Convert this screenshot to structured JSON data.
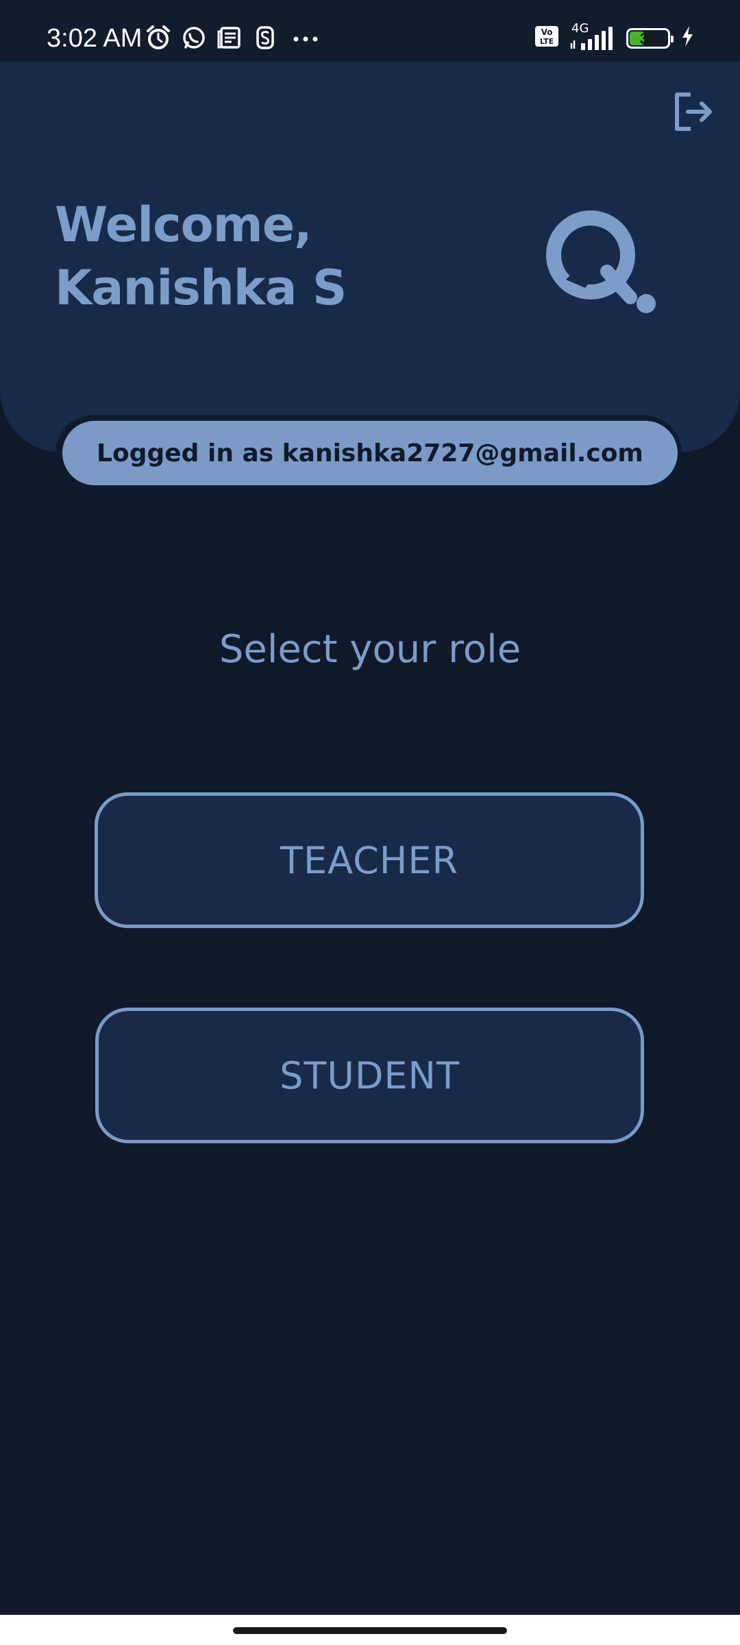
{
  "status_bar": {
    "time": "3:02 AM",
    "battery_level": "39",
    "battery_fraction": 0.39,
    "network": "4G",
    "icons_left": [
      "alarm-icon",
      "whatsapp-icon",
      "news-icon",
      "app-s-icon",
      "more-dots-icon"
    ],
    "icons_right": [
      "volte-icon",
      "signal-icon",
      "battery-icon",
      "charging-icon"
    ]
  },
  "header": {
    "welcome": "Welcome, Kanishka S",
    "logout_icon": "logout-icon",
    "logo_icon": "app-logo-icon"
  },
  "login": {
    "label": "Logged in as kanishka2727@gmail.com"
  },
  "main": {
    "prompt": "Select your role",
    "teacher_label": "TEACHER",
    "student_label": "STUDENT"
  },
  "colors": {
    "background": "#0f192a",
    "card": "#182a4a",
    "accent": "#7c9cc9",
    "pill": "#7b9ac7",
    "battery_green": "#4caf2f"
  }
}
